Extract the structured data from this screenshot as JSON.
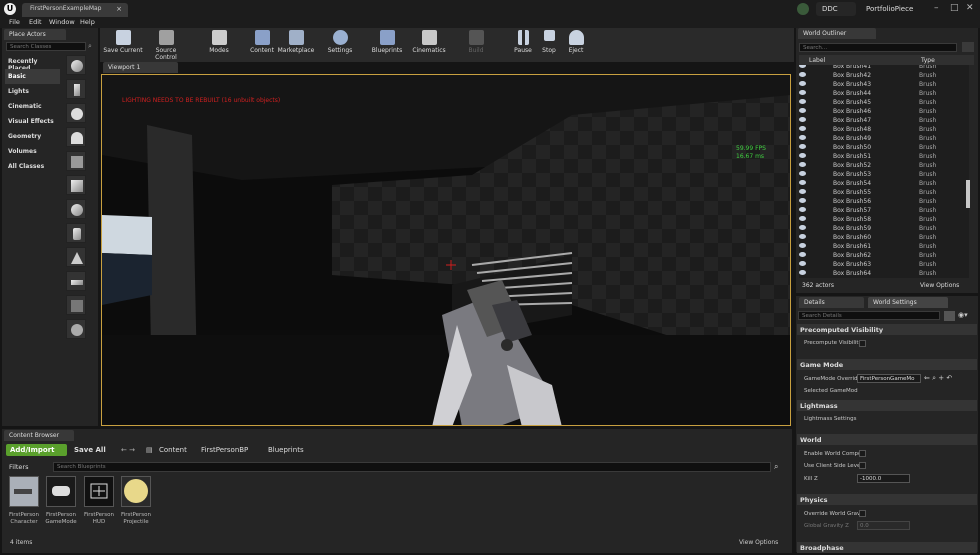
{
  "titlebar": {
    "doc_tab": "FirstPersonExampleMap",
    "ddc_label": "DDC",
    "project_label": "PortfolioPiece"
  },
  "menu": [
    "File",
    "Edit",
    "Window",
    "Help"
  ],
  "place_actors": {
    "tab": "Place Actors",
    "search_placeholder": "Search Classes",
    "categories": [
      "Recently Placed",
      "Basic",
      "Lights",
      "Cinematic",
      "Visual Effects",
      "Geometry",
      "Volumes",
      "All Classes"
    ],
    "selected": "Basic"
  },
  "toolbar": [
    "Save Current",
    "Source Control",
    "Modes",
    "Content",
    "Marketplace",
    "Settings",
    "Blueprints",
    "Cinematics",
    "Build",
    "Pause",
    "Stop",
    "Eject"
  ],
  "viewport": {
    "tab": "Viewport 1",
    "warning": "LIGHTING NEEDS TO BE REBUILT (16 unbuilt objects)",
    "fps": "59.99 FPS",
    "ms": "16.67 ms"
  },
  "outliner": {
    "tab": "World Outliner",
    "search_placeholder": "Search...",
    "col_label": "Label",
    "col_type": "Type",
    "rows": [
      {
        "label": "Box Brush41",
        "type": "Brush"
      },
      {
        "label": "Box Brush42",
        "type": "Brush"
      },
      {
        "label": "Box Brush43",
        "type": "Brush"
      },
      {
        "label": "Box Brush44",
        "type": "Brush"
      },
      {
        "label": "Box Brush45",
        "type": "Brush"
      },
      {
        "label": "Box Brush46",
        "type": "Brush"
      },
      {
        "label": "Box Brush47",
        "type": "Brush"
      },
      {
        "label": "Box Brush48",
        "type": "Brush"
      },
      {
        "label": "Box Brush49",
        "type": "Brush"
      },
      {
        "label": "Box Brush50",
        "type": "Brush"
      },
      {
        "label": "Box Brush51",
        "type": "Brush"
      },
      {
        "label": "Box Brush52",
        "type": "Brush"
      },
      {
        "label": "Box Brush53",
        "type": "Brush"
      },
      {
        "label": "Box Brush54",
        "type": "Brush"
      },
      {
        "label": "Box Brush55",
        "type": "Brush"
      },
      {
        "label": "Box Brush56",
        "type": "Brush"
      },
      {
        "label": "Box Brush57",
        "type": "Brush"
      },
      {
        "label": "Box Brush58",
        "type": "Brush"
      },
      {
        "label": "Box Brush59",
        "type": "Brush"
      },
      {
        "label": "Box Brush60",
        "type": "Brush"
      },
      {
        "label": "Box Brush61",
        "type": "Brush"
      },
      {
        "label": "Box Brush62",
        "type": "Brush"
      },
      {
        "label": "Box Brush63",
        "type": "Brush"
      },
      {
        "label": "Box Brush64",
        "type": "Brush"
      }
    ],
    "count": "362 actors",
    "view_options": "View Options"
  },
  "details": {
    "tab_details": "Details",
    "tab_world": "World Settings",
    "search_placeholder": "Search Details",
    "sections": {
      "precomputed": "Precomputed Visibility",
      "gamemode": "Game Mode",
      "lightmass": "Lightmass",
      "world": "World",
      "physics": "Physics",
      "broadphase": "Broadphase"
    },
    "props": {
      "precompute": "Precompute Visibilit",
      "gamemode_override": "GameMode Override",
      "gamemode_value": "FirstPersonGameMo",
      "selected_gamemode": "Selected GameMod",
      "lightmass_settings": "Lightmass Settings",
      "enable_world": "Enable World Compo",
      "client_side": "Use Client Side Leve",
      "killz": "Kill Z",
      "killz_value": "-1000.0",
      "override_gravity": "Override World Gravi",
      "global_gravity": "Global Gravity Z",
      "gravity_value": "0.0"
    }
  },
  "content_browser": {
    "tab": "Content Browser",
    "add_import": "Add/Import",
    "save_all": "Save All",
    "path": [
      "Content",
      "FirstPersonBP",
      "Blueprints"
    ],
    "filters": "Filters",
    "search_placeholder": "Search Blueprints",
    "assets": [
      {
        "line1": "FirstPerson",
        "line2": "Character"
      },
      {
        "line1": "FirstPerson",
        "line2": "GameMode"
      },
      {
        "line1": "FirstPerson",
        "line2": "HUD"
      },
      {
        "line1": "FirstPerson",
        "line2": "Projectile"
      }
    ],
    "count": "4 items",
    "view_options": "View Options"
  },
  "colors": {
    "accent_green": "#5aa02c",
    "viewport_border": "#c8a040",
    "warning": "#d02020",
    "fps": "#40d040",
    "eye_icon": "#c8d2e0"
  }
}
